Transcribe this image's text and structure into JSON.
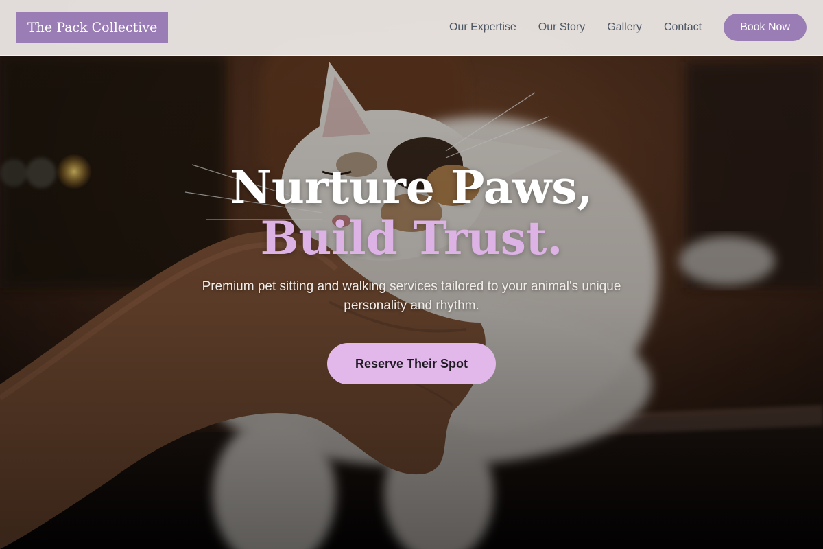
{
  "header": {
    "logo_text": "The Pack Collective",
    "nav": [
      {
        "label": "Our Expertise"
      },
      {
        "label": "Our Story"
      },
      {
        "label": "Gallery"
      },
      {
        "label": "Contact"
      }
    ],
    "book_label": "Book Now"
  },
  "hero": {
    "headline_line1": "Nurture Paws,",
    "headline_line2": "Build Trust.",
    "subtitle": "Premium pet sitting and walking services tailored to your animal's unique personality and rhythm.",
    "cta_label": "Reserve Their Spot",
    "image_subject": "cat-being-petted-photo"
  },
  "colors": {
    "accent": "#9a7db4",
    "highlight": "#dcb3e4",
    "cta_bg": "#e2b8ea"
  }
}
